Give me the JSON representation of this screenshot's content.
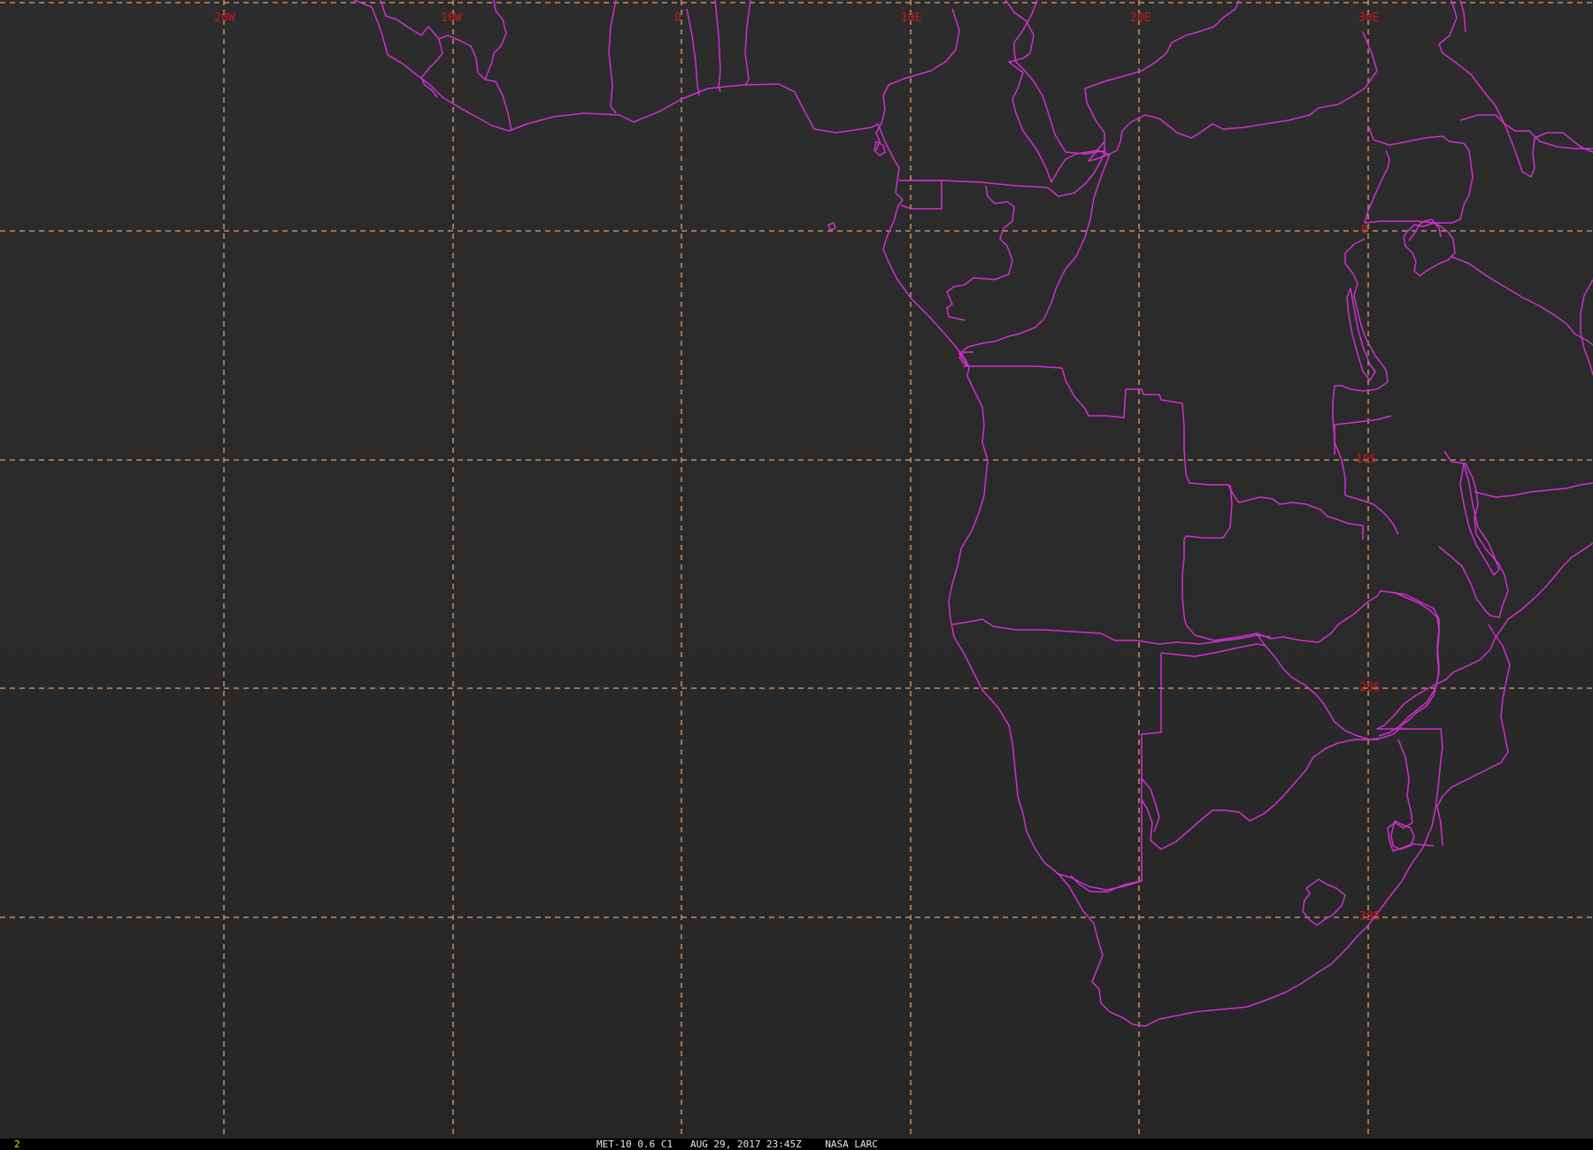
{
  "map": {
    "grid_labels": {
      "lon": [
        "20W",
        "10W",
        "0",
        "10E",
        "20E",
        "30E"
      ],
      "lat": [
        "0",
        "10S",
        "20S",
        "30S"
      ]
    },
    "colors": {
      "background": "#2a2a2a",
      "gridline": "#e0a070",
      "grid_label": "#c81818",
      "border": "#d12fd1"
    }
  },
  "status_bar": {
    "frame_number": "2",
    "satellite_product": "MET-10 0.6 C1",
    "datetime": "AUG 29, 2017 23:45Z",
    "source": "NASA LARC"
  }
}
